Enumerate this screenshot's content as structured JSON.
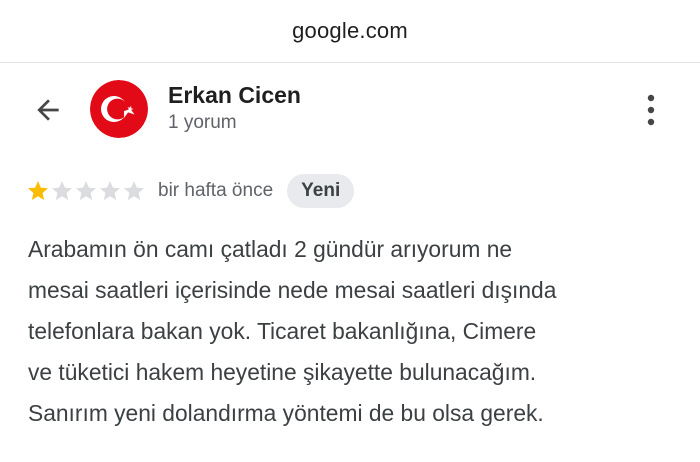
{
  "browser": {
    "domain": "google.com"
  },
  "reviewer": {
    "name": "Erkan Cicen",
    "review_count": "1 yorum",
    "avatar_icon": "turkey-flag-icon"
  },
  "icons": {
    "back": "arrow-left-icon",
    "more": "more-vert-icon",
    "star": "star-icon"
  },
  "review": {
    "rating": 1,
    "rating_max": 5,
    "time_ago": "bir hafta önce",
    "badge": "Yeni",
    "text_lines": [
      "Arabamın ön camı çatladı 2 gündür arıyorum ne",
      "mesai saatleri içerisinde nede mesai saatleri dışında",
      "telefonlara bakan yok. Ticaret bakanlığına, Cimere",
      "ve tüketici hakem heyetine şikayette bulunacağım.",
      "Sanırım yeni dolandırma yöntemi de bu olsa gerek."
    ]
  },
  "colors": {
    "star_filled": "#fbbc04",
    "star_empty": "#dadce0",
    "flag_red": "#e30a17"
  }
}
